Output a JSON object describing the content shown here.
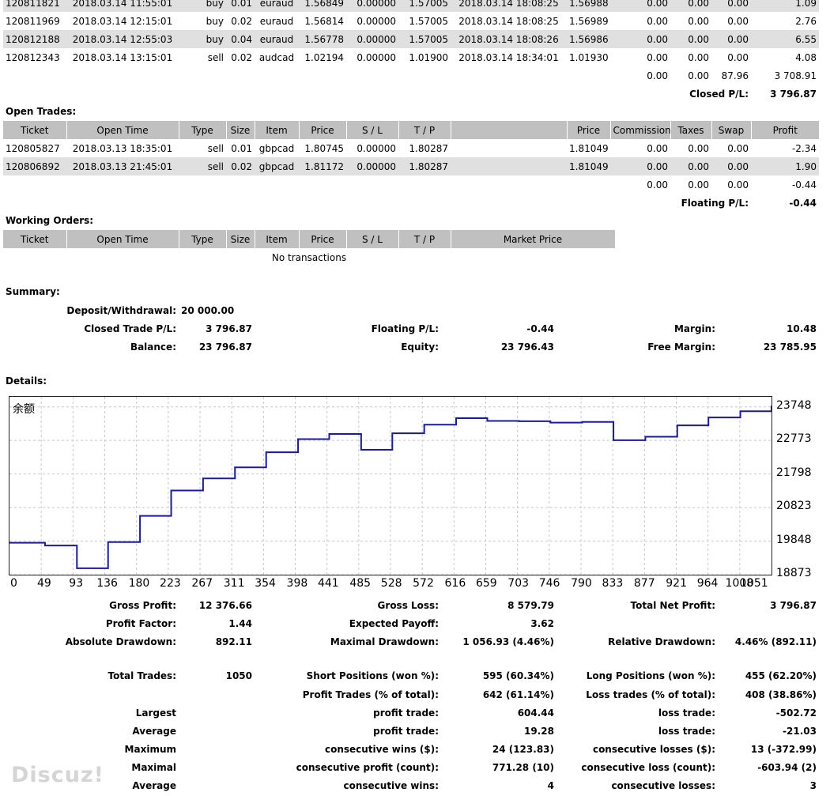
{
  "closed_rows": [
    {
      "ticket": "120811821",
      "open_time": "2018.03.14 11:55:01",
      "type": "buy",
      "size": "0.01",
      "item": "euraud",
      "price": "1.56849",
      "sl": "0.00000",
      "tp": "1.57005",
      "close_time": "2018.03.14 18:08:25",
      "close_price": "1.56988",
      "commission": "0.00",
      "taxes": "0.00",
      "swap": "0.00",
      "profit": "1.09"
    },
    {
      "ticket": "120811969",
      "open_time": "2018.03.14 12:15:01",
      "type": "buy",
      "size": "0.02",
      "item": "euraud",
      "price": "1.56814",
      "sl": "0.00000",
      "tp": "1.57005",
      "close_time": "2018.03.14 18:08:25",
      "close_price": "1.56989",
      "commission": "0.00",
      "taxes": "0.00",
      "swap": "0.00",
      "profit": "2.76"
    },
    {
      "ticket": "120812188",
      "open_time": "2018.03.14 12:55:03",
      "type": "buy",
      "size": "0.04",
      "item": "euraud",
      "price": "1.56778",
      "sl": "0.00000",
      "tp": "1.57005",
      "close_time": "2018.03.14 18:08:26",
      "close_price": "1.56986",
      "commission": "0.00",
      "taxes": "0.00",
      "swap": "0.00",
      "profit": "6.55"
    },
    {
      "ticket": "120812343",
      "open_time": "2018.03.14 13:15:01",
      "type": "sell",
      "size": "0.02",
      "item": "audcad",
      "price": "1.02194",
      "sl": "0.00000",
      "tp": "1.01900",
      "close_time": "2018.03.14 18:34:01",
      "close_price": "1.01930",
      "commission": "0.00",
      "taxes": "0.00",
      "swap": "0.00",
      "profit": "4.08"
    }
  ],
  "closed_totals": {
    "commission": "0.00",
    "taxes": "0.00",
    "swap": "87.96",
    "profit": "3 708.91"
  },
  "closed_pl": {
    "label": "Closed P/L:",
    "value": "3 796.87"
  },
  "open_trades_title": "Open Trades:",
  "columns": {
    "ticket": "Ticket",
    "open_time": "Open Time",
    "type": "Type",
    "size": "Size",
    "item": "Item",
    "price": "Price",
    "sl": "S / L",
    "tp": "T / P",
    "price2": "Price",
    "commission": "Commission",
    "taxes": "Taxes",
    "swap": "Swap",
    "profit": "Profit",
    "market_price": "Market Price"
  },
  "open_rows": [
    {
      "ticket": "120805827",
      "open_time": "2018.03.13 18:35:01",
      "type": "sell",
      "size": "0.01",
      "item": "gbpcad",
      "price": "1.80745",
      "sl": "0.00000",
      "tp": "1.80287",
      "cur_price": "1.81049",
      "commission": "0.00",
      "taxes": "0.00",
      "swap": "0.00",
      "profit": "-2.34"
    },
    {
      "ticket": "120806892",
      "open_time": "2018.03.13 21:45:01",
      "type": "sell",
      "size": "0.02",
      "item": "gbpcad",
      "price": "1.81172",
      "sl": "0.00000",
      "tp": "1.80287",
      "cur_price": "1.81049",
      "commission": "0.00",
      "taxes": "0.00",
      "swap": "0.00",
      "profit": "1.90"
    }
  ],
  "open_totals": {
    "commission": "0.00",
    "taxes": "0.00",
    "swap": "0.00",
    "profit": "-0.44"
  },
  "floating_pl": {
    "label": "Floating P/L:",
    "value": "-0.44"
  },
  "working_orders_title": "Working Orders:",
  "no_transactions": "No transactions",
  "summary": {
    "title": "Summary:",
    "deposit_label": "Deposit/Withdrawal:",
    "deposit": "20 000.00",
    "closed_label": "Closed Trade P/L:",
    "closed": "3 796.87",
    "floating_label": "Floating P/L:",
    "floating": "-0.44",
    "margin_label": "Margin:",
    "margin": "10.48",
    "balance_label": "Balance:",
    "balance": "23 796.87",
    "equity_label": "Equity:",
    "equity": "23 796.43",
    "free_margin_label": "Free Margin:",
    "free_margin": "23 785.95"
  },
  "details_title": "Details:",
  "chart_data": {
    "type": "line",
    "title": "余额",
    "x": [
      0,
      49,
      93,
      136,
      180,
      223,
      267,
      311,
      354,
      398,
      441,
      485,
      528,
      572,
      616,
      659,
      703,
      746,
      790,
      833,
      877,
      921,
      964,
      1008,
      1051
    ],
    "y": [
      19800,
      19720,
      19060,
      19820,
      20580,
      21320,
      21670,
      21990,
      22430,
      22810,
      22960,
      22500,
      22980,
      23230,
      23420,
      23340,
      23330,
      23290,
      23310,
      22780,
      22880,
      23210,
      23440,
      23620,
      23770
    ],
    "xlim": [
      0,
      1051
    ],
    "ylim": [
      18873,
      24040
    ],
    "yticks": [
      "23748",
      "22773",
      "21798",
      "20823",
      "19848",
      "18873"
    ],
    "xticks": [
      "0",
      "49",
      "93",
      "136",
      "180",
      "223",
      "267",
      "311",
      "354",
      "398",
      "441",
      "485",
      "528",
      "572",
      "616",
      "659",
      "703",
      "746",
      "790",
      "833",
      "877",
      "921",
      "964",
      "1008",
      "1051"
    ],
    "grid": true,
    "line_color": "#1a1aa6"
  },
  "stats": [
    [
      {
        "l": "Gross Profit:",
        "v": "12 376.66"
      },
      {
        "l": "Gross Loss:",
        "v": "8 579.79"
      },
      {
        "l": "Total Net Profit:",
        "v": "3 796.87"
      }
    ],
    [
      {
        "l": "Profit Factor:",
        "v": "1.44"
      },
      {
        "l": "Expected Payoff:",
        "v": "3.62"
      },
      {
        "l": "",
        "v": ""
      }
    ],
    [
      {
        "l": "Absolute Drawdown:",
        "v": "892.11"
      },
      {
        "l": "Maximal Drawdown:",
        "v": "1 056.93 (4.46%)"
      },
      {
        "l": "Relative Drawdown:",
        "v": "4.46% (892.11)"
      }
    ],
    [
      {
        "l": "Total Trades:",
        "v": "1050"
      },
      {
        "l": "Short Positions (won %):",
        "v": "595 (60.34%)"
      },
      {
        "l": "Long Positions (won %):",
        "v": "455 (62.20%)"
      }
    ],
    [
      {
        "l": "",
        "v": ""
      },
      {
        "l": "Profit Trades (% of total):",
        "v": "642 (61.14%)"
      },
      {
        "l": "Loss trades (% of total):",
        "v": "408 (38.86%)"
      }
    ],
    [
      {
        "l": "Largest",
        "v": ""
      },
      {
        "l": "profit trade:",
        "v": "604.44"
      },
      {
        "l": "loss trade:",
        "v": "-502.72"
      }
    ],
    [
      {
        "l": "Average",
        "v": ""
      },
      {
        "l": "profit trade:",
        "v": "19.28"
      },
      {
        "l": "loss trade:",
        "v": "-21.03"
      }
    ],
    [
      {
        "l": "Maximum",
        "v": ""
      },
      {
        "l": "consecutive wins ($):",
        "v": "24 (123.83)"
      },
      {
        "l": "consecutive losses ($):",
        "v": "13 (-372.99)"
      }
    ],
    [
      {
        "l": "Maximal",
        "v": ""
      },
      {
        "l": "consecutive profit (count):",
        "v": "771.28 (10)"
      },
      {
        "l": "consecutive loss (count):",
        "v": "-603.94 (2)"
      }
    ],
    [
      {
        "l": "Average",
        "v": ""
      },
      {
        "l": "consecutive wins:",
        "v": "4"
      },
      {
        "l": "consecutive losses:",
        "v": "3"
      }
    ]
  ],
  "watermark": "Discuz!"
}
